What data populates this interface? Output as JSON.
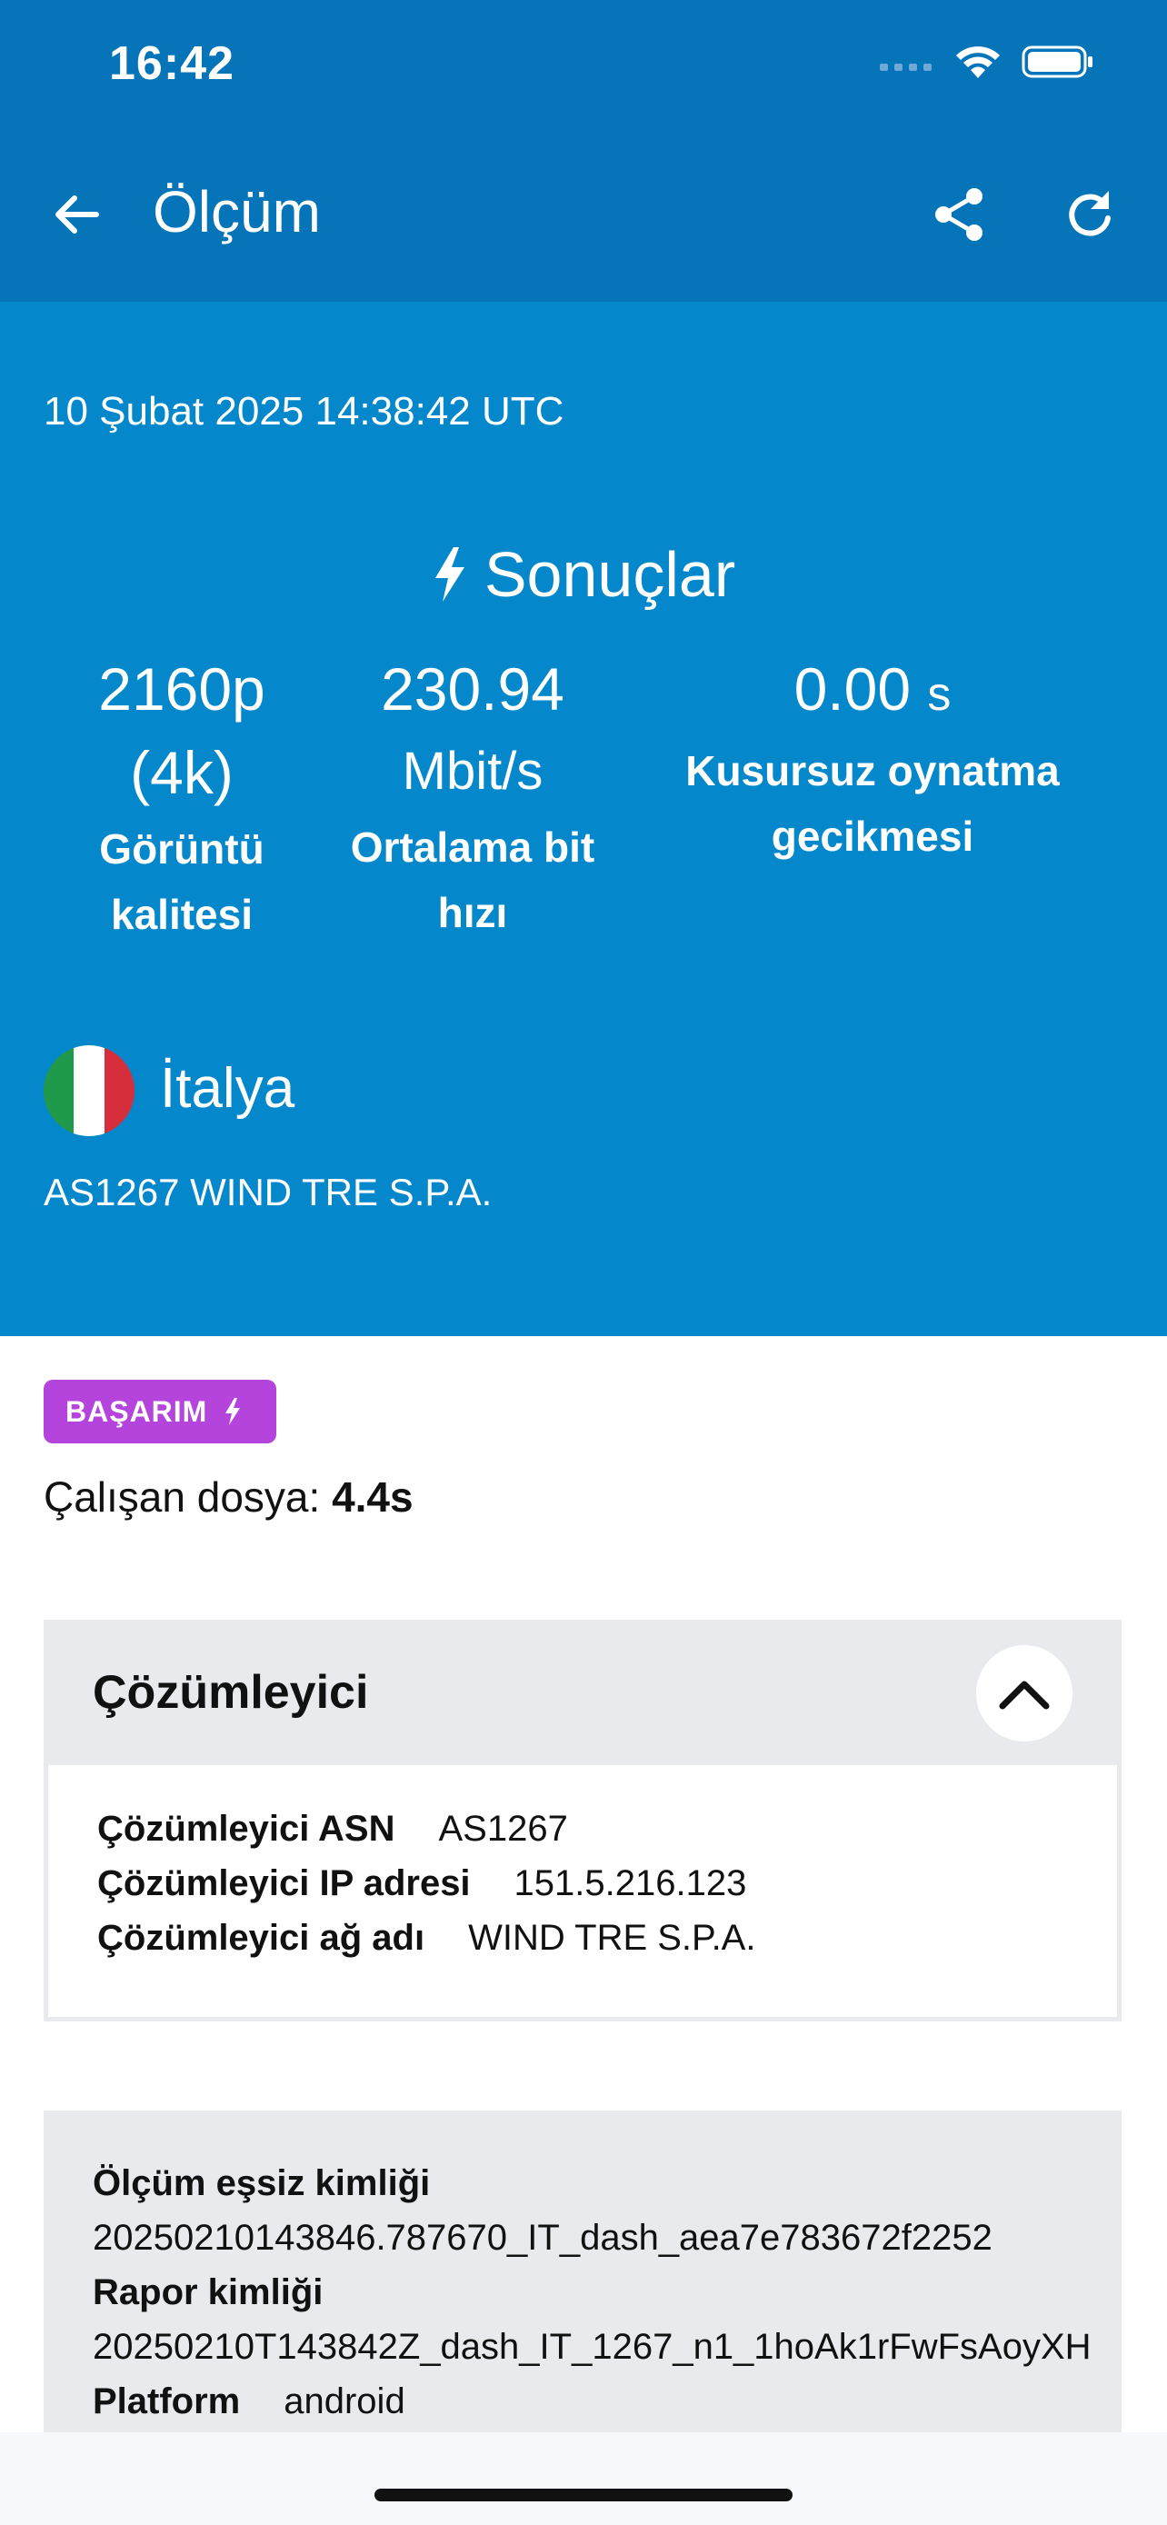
{
  "status_bar": {
    "time": "16:42"
  },
  "app_bar": {
    "title": "Ölçüm",
    "icons": [
      "back-arrow-icon",
      "share-icon",
      "refresh-icon"
    ]
  },
  "hero": {
    "date": "10 Şubat 2025 14:38:42 UTC",
    "results_title": "Sonuçlar",
    "metrics": [
      {
        "value_line1": "2160p",
        "value_line2": "(4k)",
        "label_line1": "Görüntü",
        "label_line2": "kalitesi"
      },
      {
        "value": "230.94",
        "unit": "Mbit/s",
        "label_line1": "Ortalama bit",
        "label_line2": "hızı"
      },
      {
        "value": "0.00",
        "unit": "s",
        "label_line1": "Kusursuz oynatma",
        "label_line2": "gecikmesi"
      }
    ],
    "country": "İtalya",
    "network": "AS1267 WIND TRE S.P.A."
  },
  "badge": {
    "label": "BAŞARIM"
  },
  "runtime": {
    "label": "Çalışan dosya:",
    "value": "4.4s"
  },
  "resolver": {
    "title": "Çözümleyici",
    "rows": [
      {
        "key": "Çözümleyici ASN",
        "value": "AS1267"
      },
      {
        "key": "Çözümleyici IP adresi",
        "value": "151.5.216.123"
      },
      {
        "key": "Çözümleyici ağ adı",
        "value": "WIND TRE S.P.A."
      }
    ]
  },
  "info": {
    "measurement_id_label": "Ölçüm eşsiz kimliği",
    "measurement_id": "20250210143846.787670_IT_dash_aea7e783672f2252",
    "report_id_label": "Rapor kimliği",
    "report_id": "20250210T143842Z_dash_IT_1267_n1_1hoAk1rFwFsAoyXH",
    "platform_label": "Platform",
    "platform": "android"
  },
  "colors": {
    "app_bar": "#0674B8",
    "hero": "#0588CB",
    "badge": "#B444DB",
    "card_bg": "#E8EAED"
  }
}
